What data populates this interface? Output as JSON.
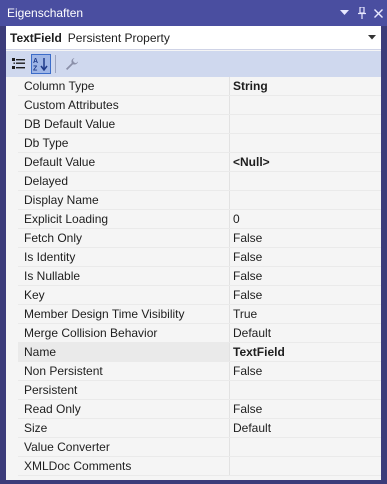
{
  "window": {
    "title": "Eigenschaften"
  },
  "object_selector": {
    "name": "TextField",
    "type": "Persistent Property"
  },
  "toolbar": {
    "categorized_icon": "categorized-icon",
    "alphabetical_icon": "alphabetical-sort-icon",
    "property_pages_icon": "wrench-icon"
  },
  "properties": [
    {
      "name": "Column Type",
      "value": "String",
      "bold": true
    },
    {
      "name": "Custom Attributes",
      "value": "",
      "bold": false
    },
    {
      "name": "DB Default Value",
      "value": "",
      "bold": false
    },
    {
      "name": "Db Type",
      "value": "",
      "bold": false
    },
    {
      "name": "Default Value",
      "value": "<Null>",
      "bold": true
    },
    {
      "name": "Delayed",
      "value": "",
      "bold": false
    },
    {
      "name": "Display Name",
      "value": "",
      "bold": false
    },
    {
      "name": "Explicit Loading",
      "value": "0",
      "bold": false
    },
    {
      "name": "Fetch Only",
      "value": "False",
      "bold": false
    },
    {
      "name": "Is Identity",
      "value": "False",
      "bold": false
    },
    {
      "name": "Is Nullable",
      "value": "False",
      "bold": false
    },
    {
      "name": "Key",
      "value": "False",
      "bold": false
    },
    {
      "name": "Member Design Time Visibility",
      "value": "True",
      "bold": false
    },
    {
      "name": "Merge Collision Behavior",
      "value": "Default",
      "bold": false
    },
    {
      "name": "Name",
      "value": "TextField",
      "bold": true
    },
    {
      "name": "Non Persistent",
      "value": "False",
      "bold": false
    },
    {
      "name": "Persistent",
      "value": "",
      "bold": false
    },
    {
      "name": "Read Only",
      "value": "False",
      "bold": false
    },
    {
      "name": "Size",
      "value": "Default",
      "bold": false
    },
    {
      "name": "Value Converter",
      "value": "",
      "bold": false
    },
    {
      "name": "XMLDoc Comments",
      "value": "",
      "bold": false
    }
  ],
  "selected_property": "Name",
  "colors": {
    "titlebar": "#4a4ea0",
    "toolbar": "#cfd8ee",
    "grid_background": "#f5f5f5"
  }
}
